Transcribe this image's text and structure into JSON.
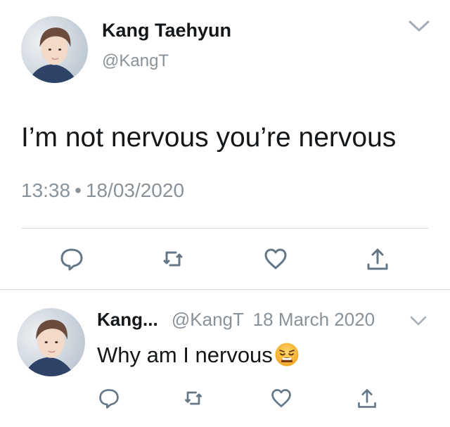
{
  "main_tweet": {
    "author_name": "Kang Taehyun",
    "author_handle": "@KangT",
    "text": "I’m not nervous you’re nervous",
    "time": "13:38",
    "separator": "•",
    "date": "18/03/2020"
  },
  "reply_tweet": {
    "author_name": "Kang...",
    "author_handle": "@KangT",
    "date": "18 March 2020",
    "text": "Why am I nervous",
    "emoji_icon": "weary-face-icon"
  },
  "actions": [
    "reply-icon",
    "retweet-icon",
    "like-icon",
    "share-icon"
  ],
  "colors": {
    "icon": "#657786",
    "muted_text": "#8a9299",
    "divider": "#d8dde1"
  }
}
